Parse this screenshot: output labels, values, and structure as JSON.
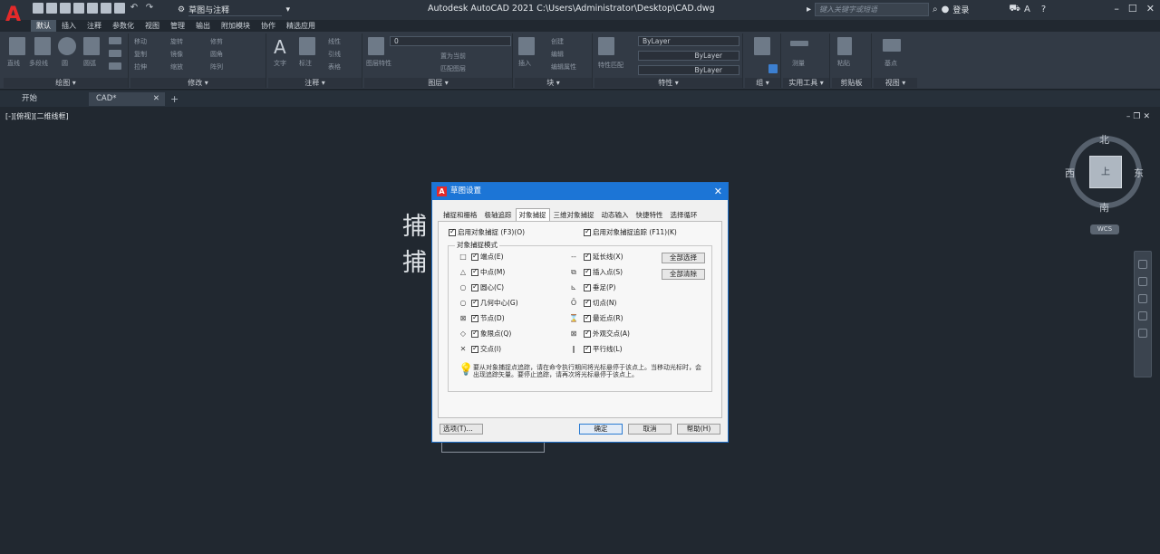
{
  "titlebar": {
    "app_title": "Autodesk AutoCAD 2021   C:\\Users\\Administrator\\Desktop\\CAD.dwg",
    "workspace": "草图与注释",
    "search_placeholder": "键入关键字或短语",
    "login": "登录",
    "logo": "A"
  },
  "ribbon_tabs": [
    "默认",
    "插入",
    "注释",
    "参数化",
    "视图",
    "管理",
    "输出",
    "附加模块",
    "协作",
    "精选应用"
  ],
  "ribbon": {
    "panels": [
      {
        "title": "绘图 ▾",
        "labels": [
          "直线",
          "多段线",
          "圆",
          "圆弧"
        ]
      },
      {
        "title": "修改 ▾",
        "labels": [
          "移动",
          "旋转",
          "修剪",
          "复制",
          "镜像",
          "圆角",
          "拉伸",
          "缩放",
          "阵列"
        ]
      },
      {
        "title": "注释 ▾",
        "labels": [
          "文字",
          "标注",
          "线性",
          "引线",
          "表格"
        ]
      },
      {
        "title": "图层 ▾",
        "labels": [
          "图层特性",
          "置为当前",
          "匹配图层"
        ]
      },
      {
        "title": "块 ▾",
        "labels": [
          "插入",
          "创建",
          "编辑",
          "编辑属性"
        ]
      },
      {
        "title": "特性 ▾",
        "labels": [
          "特性匹配"
        ]
      },
      {
        "title": "组 ▾",
        "labels": [
          "组"
        ]
      },
      {
        "title": "实用工具 ▾",
        "labels": [
          "测量"
        ]
      },
      {
        "title": "剪贴板",
        "labels": [
          "粘贴"
        ]
      },
      {
        "title": "视图 ▾",
        "labels": [
          "基点"
        ]
      }
    ],
    "layer_value": "0",
    "bylayer_1": "ByLayer",
    "bylayer_2": "ByLayer",
    "bylayer_3": "ByLayer"
  },
  "doc_tabs": [
    {
      "label": "开始"
    },
    {
      "label": "CAD*"
    }
  ],
  "viewport": {
    "label": "[-][俯视][二维线框]",
    "bg_text_1": "捕",
    "bg_text_2": "捕"
  },
  "viewcube": {
    "north": "北",
    "south": "南",
    "east": "东",
    "west": "西",
    "face": "上",
    "wcs": "WCS"
  },
  "dialog": {
    "title": "草图设置",
    "tabs": [
      "捕捉和栅格",
      "极轴追踪",
      "对象捕捉",
      "三维对象捕捉",
      "动态输入",
      "快捷特性",
      "选择循环"
    ],
    "active_tab": 2,
    "enable_osnap": "启用对象捕捉 (F3)(O)",
    "enable_tracking": "启用对象捕捉追踪 (F11)(K)",
    "mode_group": "对象捕捉模式",
    "left_modes": [
      {
        "sym": "□",
        "label": "端点(E)"
      },
      {
        "sym": "△",
        "label": "中点(M)"
      },
      {
        "sym": "○",
        "label": "圆心(C)"
      },
      {
        "sym": "○",
        "label": "几何中心(G)"
      },
      {
        "sym": "⊠",
        "label": "节点(D)"
      },
      {
        "sym": "◇",
        "label": "象限点(Q)"
      },
      {
        "sym": "✕",
        "label": "交点(I)"
      }
    ],
    "right_modes": [
      {
        "sym": "--",
        "label": "延长线(X)"
      },
      {
        "sym": "⧉",
        "label": "插入点(S)"
      },
      {
        "sym": "⊾",
        "label": "垂足(P)"
      },
      {
        "sym": "Ō",
        "label": "切点(N)"
      },
      {
        "sym": "⌛",
        "label": "最近点(R)"
      },
      {
        "sym": "⊠",
        "label": "外观交点(A)"
      },
      {
        "sym": "∥",
        "label": "平行线(L)"
      }
    ],
    "select_all": "全部选择",
    "clear_all": "全部清除",
    "tip": "要从对象捕捉点追踪，请在命令执行期间将光标悬停于该点上。当移动光标时，会出现追踪矢量。要停止追踪，请再次将光标悬停于该点上。",
    "options": "选项(T)...",
    "ok": "确定",
    "cancel": "取消",
    "help": "帮助(H)"
  }
}
